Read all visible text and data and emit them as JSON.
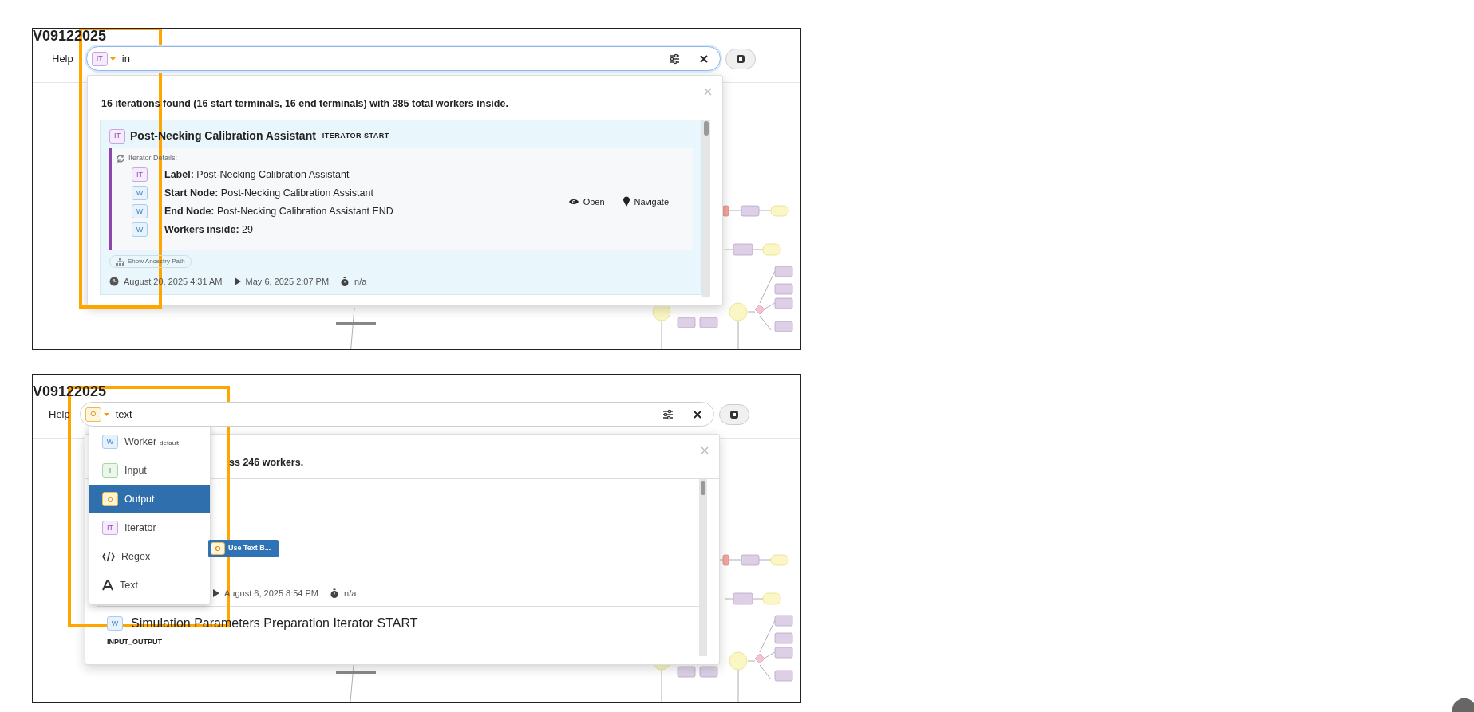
{
  "panels": [
    {
      "title": "V09122025",
      "menu_item": "Help",
      "search": {
        "badge": {
          "text": "IT",
          "kind": "iterator"
        },
        "value": "in",
        "focused": true
      },
      "results": {
        "summary": "16 iterations found (16 start terminals, 16 end terminals) with 385 total workers inside.",
        "cards": [
          {
            "kind": "iteration",
            "badge": {
              "text": "IT",
              "kind": "iterator"
            },
            "title": "Post-Necking Calibration Assistant",
            "tag": "ITERATOR START",
            "details_heading": "Iterator Details:",
            "details": [
              {
                "badge": {
                  "text": "IT",
                  "kind": "iterator"
                },
                "label": "Label:",
                "value": "Post-Necking Calibration Assistant"
              },
              {
                "badge": {
                  "text": "W",
                  "kind": "worker"
                },
                "label": "Start Node:",
                "value": "Post-Necking Calibration Assistant"
              },
              {
                "badge": {
                  "text": "W",
                  "kind": "worker"
                },
                "label": "End Node:",
                "value": "Post-Necking Calibration Assistant END"
              },
              {
                "badge": {
                  "text": "W",
                  "kind": "worker"
                },
                "label": "Workers inside:",
                "value": "29"
              }
            ],
            "actions": [
              "Open",
              "Navigate"
            ],
            "ancestry": "Show Ancestry Path",
            "created": "August 20, 2025 4:31 AM",
            "run": "May 6, 2025 2:07 PM",
            "duration": "n/a"
          }
        ]
      }
    },
    {
      "title": "V09122025",
      "menu_item": "Help",
      "search": {
        "badge": {
          "text": "O",
          "kind": "output"
        },
        "value": "text",
        "focused": false
      },
      "results": {
        "summary": "ss 246 workers.",
        "cards": [
          {
            "kind": "partial",
            "button": {
              "badge": {
                "text": "O",
                "kind": "output"
              },
              "label": "Use Text B..."
            },
            "run": "August 6, 2025 8:54 PM",
            "duration": "n/a"
          },
          {
            "kind": "heading",
            "badge": {
              "text": "W",
              "kind": "worker"
            },
            "title": "Simulation Parameters Preparation Iterator START",
            "subtitle": "INPUT_OUTPUT"
          }
        ]
      },
      "type_menu": [
        {
          "kind": "badge",
          "badge": {
            "text": "W",
            "kind": "worker"
          },
          "label": "Worker",
          "sub": "default",
          "selected": false
        },
        {
          "kind": "badge",
          "badge": {
            "text": "I",
            "kind": "input"
          },
          "label": "Input",
          "selected": false
        },
        {
          "kind": "badge",
          "badge": {
            "text": "O",
            "kind": "output"
          },
          "label": "Output",
          "selected": true
        },
        {
          "kind": "badge",
          "badge": {
            "text": "IT",
            "kind": "iterator"
          },
          "label": "Iterator",
          "selected": false
        },
        {
          "kind": "regex",
          "label": "Regex",
          "selected": false
        },
        {
          "kind": "text",
          "label": "Text",
          "selected": false
        }
      ]
    }
  ]
}
